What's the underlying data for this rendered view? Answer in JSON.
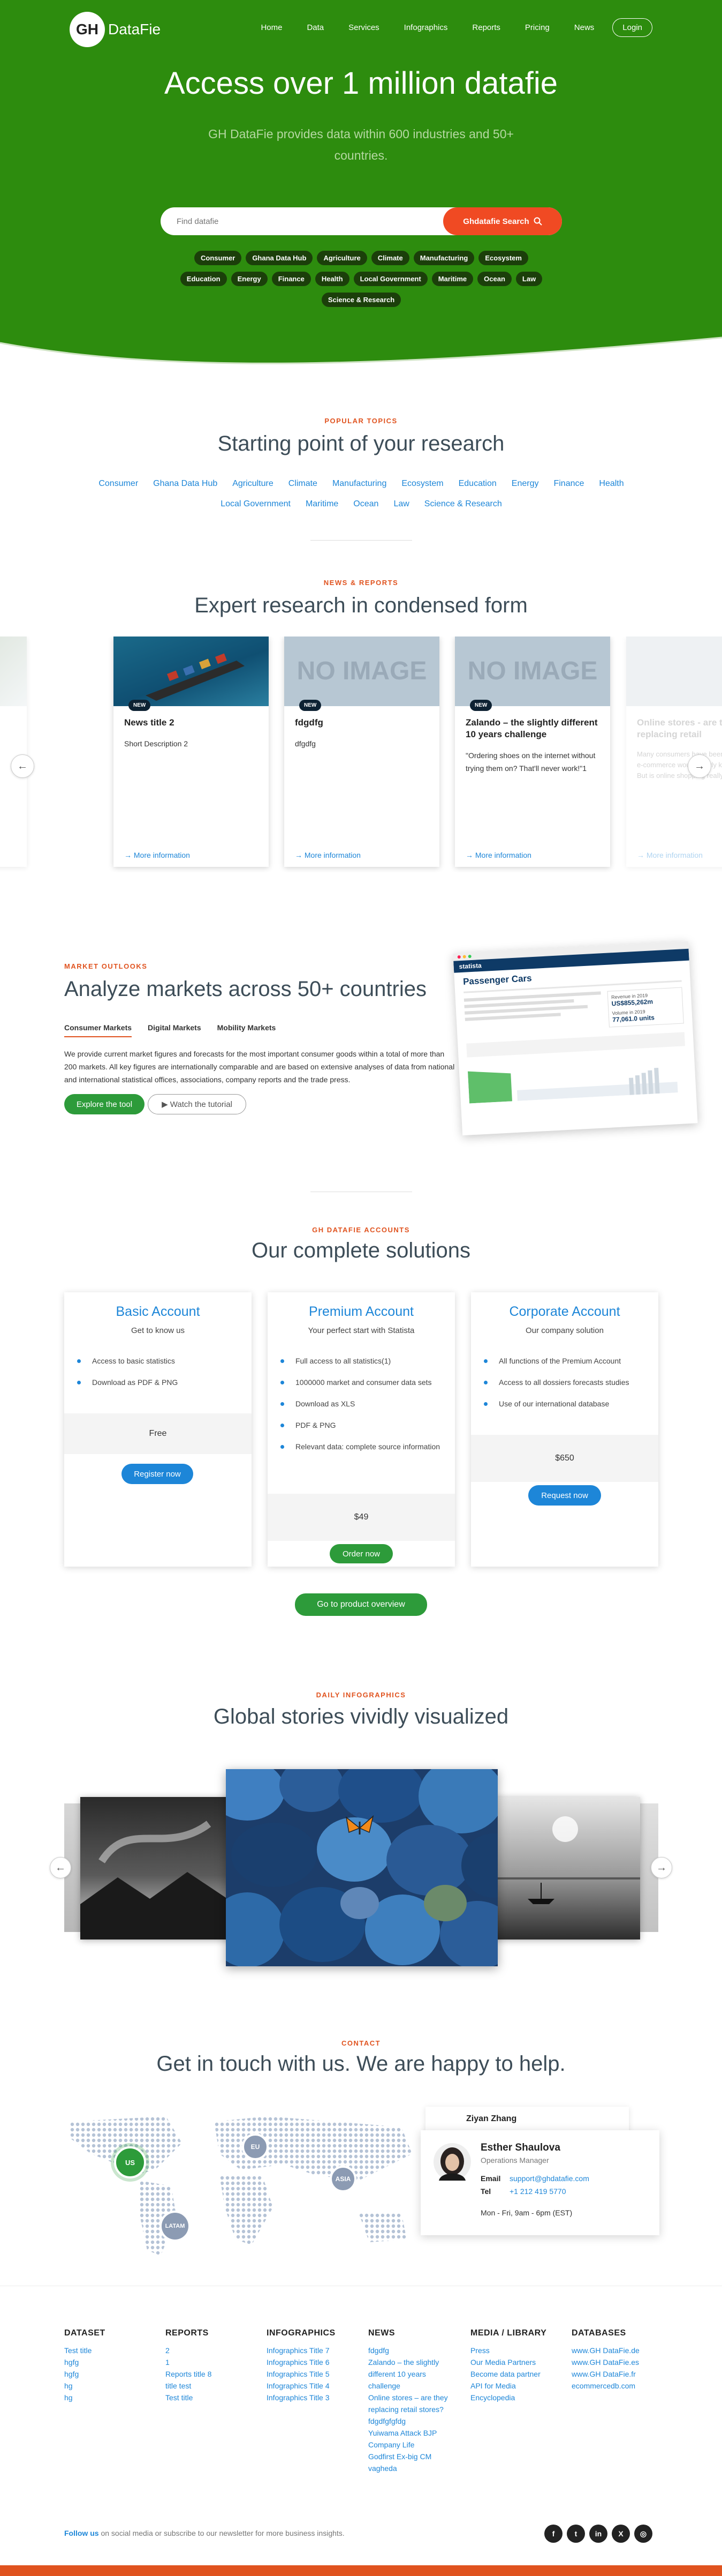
{
  "header": {
    "logo_mark": "GH",
    "logo_text": "DataFie",
    "nav": [
      "Home",
      "Data",
      "Services",
      "Infographics",
      "Reports",
      "Pricing",
      "News"
    ],
    "login": "Login"
  },
  "hero": {
    "title": "Access over 1 million datafie",
    "subtitle": "GH DataFie provides data within 600 industries and 50+ countries.",
    "search_placeholder": "Find datafie",
    "search_button": "Ghdatafie Search",
    "chips": [
      "Consumer",
      "Ghana Data Hub",
      "Agriculture",
      "Climate",
      "Manufacturing",
      "Ecosystem",
      "Education",
      "Energy",
      "Finance",
      "Health",
      "Local Government",
      "Maritime",
      "Ocean",
      "Law",
      "Science & Research"
    ]
  },
  "topics": {
    "label": "POPULAR TOPICS",
    "title": "Starting point of your research",
    "items": [
      "Consumer",
      "Ghana Data Hub",
      "Agriculture",
      "Climate",
      "Manufacturing",
      "Ecosystem",
      "Education",
      "Energy",
      "Finance",
      "Health",
      "Local Government",
      "Maritime",
      "Ocean",
      "Law",
      "Science & Research"
    ]
  },
  "news": {
    "label": "NEWS & REPORTS",
    "title": "Expert research in condensed form",
    "cards": [
      {
        "badge": "NEW",
        "title": "News title 2",
        "desc": "Short Description 2",
        "more": "More information"
      },
      {
        "badge": "NEW",
        "title": "fdgdfg",
        "desc": "dfgdfg",
        "more": "More information"
      },
      {
        "badge": "NEW",
        "title": "Zalando – the slightly different 10 years challenge",
        "desc": "\"Ordering shoes on the internet without trying them on? That'll never work!\"1",
        "more": "More information"
      },
      {
        "badge": "",
        "title": "Online stores - are they replacing retail",
        "desc": "Many consumers have been predicting that e-commerce would slowly kill retail stores. But is online shopping really...",
        "more": "More information"
      }
    ],
    "no_image": "NO IMAGE"
  },
  "market": {
    "label": "MARKET OUTLOOKS",
    "title": "Analyze markets across 50+ countries",
    "tabs": [
      "Consumer Markets",
      "Digital Markets",
      "Mobility Markets"
    ],
    "text": "We provide current market figures and forecasts for the most important consumer goods within a total of more than 200 markets. All key figures are internationally comparable and are based on extensive analyses of data from national and international statistical offices, associations, company reports and the trade press.",
    "explore": "Explore the tool",
    "watch": "Watch the tutorial",
    "mock_brand": "statista",
    "mock_title": "Passenger Cars",
    "mock_stat1": "Revenue in 2019",
    "mock_value1": "US$855,262m",
    "mock_stat2": "Volume in 2019",
    "mock_value2": "77,061.0 units"
  },
  "accounts": {
    "label": "GH DATAFIE ACCOUNTS",
    "title": "Our complete solutions",
    "plans": [
      {
        "name": "Basic Account",
        "sub": "Get to know us",
        "features": [
          "Access to basic statistics",
          "Download as PDF & PNG"
        ],
        "price": "Free",
        "button": "Register now"
      },
      {
        "name": "Premium Account",
        "sub": "Your perfect start with Statista",
        "features": [
          "Full access to all statistics(1)",
          "1000000 market and consumer data sets",
          "Download as XLS",
          "PDF & PNG",
          "Relevant data: complete source information"
        ],
        "price": "$49",
        "button": "Order now"
      },
      {
        "name": "Corporate Account",
        "sub": "Our company solution",
        "features": [
          "All functions of the Premium Account",
          "Access to all dossiers forecasts studies",
          "Use of our international database"
        ],
        "price": "$650",
        "button": "Request now"
      }
    ],
    "overview": "Go to product overview"
  },
  "infographics": {
    "label": "DAILY INFOGRAPHICS",
    "title": "Global stories vividly visualized"
  },
  "contact": {
    "label": "CONTACT",
    "title": "Get in touch with us. We are happy to help.",
    "regions": [
      "US",
      "EU",
      "ASIA",
      "LATAM"
    ],
    "back_name": "Ziyan Zhang",
    "name": "Esther Shaulova",
    "role": "Operations Manager",
    "email_label": "Email",
    "email": "support@ghdatafie.com",
    "tel_label": "Tel",
    "tel": "+1 212 419 5770",
    "hours": "Mon - Fri, 9am - 6pm (EST)"
  },
  "footer": {
    "columns": [
      {
        "title": "DATASET",
        "links": [
          "Test title",
          "hgfg",
          "hgfg",
          "hg",
          "hg"
        ]
      },
      {
        "title": "REPORTS",
        "links": [
          "2",
          "1",
          "Reports title 8",
          "title test",
          "Test title"
        ]
      },
      {
        "title": "INFOGRAPHICS",
        "links": [
          "Infographics Title 7",
          "Infographics Title 6",
          "Infographics Title 5",
          "Infographics Title 4",
          "Infographics Title 3"
        ]
      },
      {
        "title": "NEWS",
        "links": [
          "fdgdfg",
          "Zalando – the slightly different 10 years challenge",
          "Online stores – are they replacing retail stores?",
          "fdgdfgfgfdg",
          "Yuiwama Attack BJP",
          "Company Life",
          "Godfirst Ex-big CM",
          "vagheda"
        ]
      },
      {
        "title": "MEDIA / LIBRARY",
        "links": [
          "Press",
          "Our Media Partners",
          "Become data partner",
          "API for Media",
          "Encyclopedia"
        ]
      },
      {
        "title": "DATABASES",
        "links": [
          "www.GH DataFie.de",
          "www.GH DataFie.es",
          "www.GH DataFie.fr",
          "ecommercedb.com"
        ]
      }
    ],
    "follow_bold": "Follow us",
    "follow_text": "on social media or subscribe to our newsletter for more business insights.",
    "social": [
      "f",
      "t",
      "in",
      "X",
      "◎"
    ]
  },
  "colors": {
    "brand_green": "#2d8c0e",
    "accent_orange": "#f04a23",
    "link_blue": "#1d86d8",
    "button_green": "#2d9b3a",
    "footer_bar": "#e0531f"
  }
}
